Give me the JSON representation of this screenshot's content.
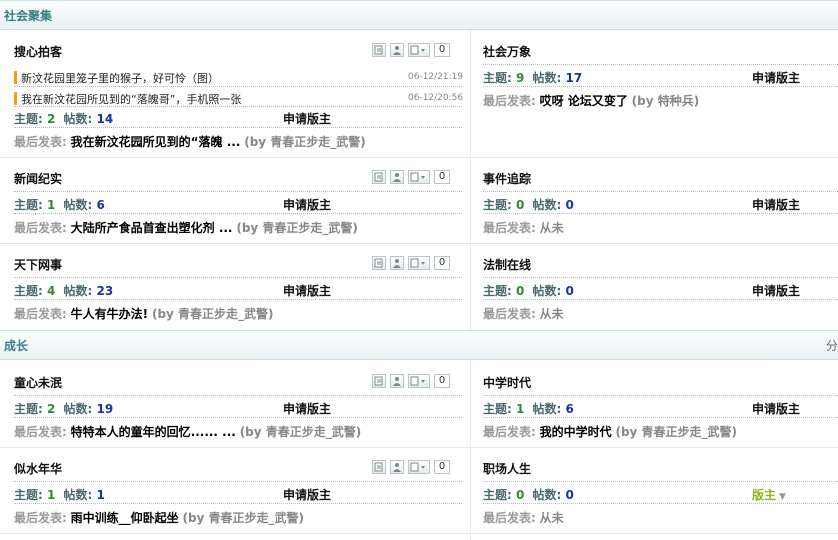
{
  "sections": {
    "s1": {
      "title": "社会聚集"
    },
    "s2": {
      "title": "成长",
      "right_glyph": "分"
    }
  },
  "labels": {
    "topics": "主题:",
    "posts": "帖数:",
    "last_post": "最后发表:",
    "never": "从未",
    "apply_moderator": "申请版主",
    "moderator": "版主"
  },
  "forums": {
    "f1": {
      "name": "搜心拍客",
      "tool_count": "0",
      "topics": "2",
      "posts": "14",
      "last_title": "我在新汶花园所见到的“落魄 ...",
      "last_by": "(by 青春正步走_武警)",
      "threads": [
        {
          "title": "新汶花园里笼子里的猴子，好可怜（图）",
          "date": "06-12/21:19"
        },
        {
          "title": "我在新汶花园所见到的“落魄哥”，手机照一张",
          "date": "06-12/20:56"
        }
      ]
    },
    "f2": {
      "name": "社会万象",
      "topics": "9",
      "posts": "17",
      "last_title": "哎呀 论坛又变了",
      "last_by": "(by 特种兵)"
    },
    "f3": {
      "name": "新闻纪实",
      "tool_count": "0",
      "topics": "1",
      "posts": "6",
      "last_title": "大陆所产食品首查出塑化剂 ...",
      "last_by": "(by 青春正步走_武警)"
    },
    "f4": {
      "name": "事件追踪",
      "topics": "0",
      "posts": "0"
    },
    "f5": {
      "name": "天下网事",
      "tool_count": "0",
      "topics": "4",
      "posts": "23",
      "last_title": "牛人有牛办法!",
      "last_by": "(by 青春正步走_武警)"
    },
    "f6": {
      "name": "法制在线",
      "topics": "0",
      "posts": "0"
    },
    "f7": {
      "name": "童心未泯",
      "tool_count": "0",
      "topics": "2",
      "posts": "19",
      "last_title": "特特本人的童年的回忆...... ...",
      "last_by": "(by 青春正步走_武警)"
    },
    "f8": {
      "name": "中学时代",
      "topics": "1",
      "posts": "6",
      "last_title": "我的中学时代",
      "last_by": "(by 青春正步走_武警)"
    },
    "f9": {
      "name": "似水年华",
      "tool_count": "0",
      "topics": "1",
      "posts": "1",
      "last_title": "雨中训练__仰卧起坐",
      "last_by": "(by 青春正步走_武警)"
    },
    "f10": {
      "name": "职场人生",
      "topics": "0",
      "posts": "0"
    }
  },
  "icons": {
    "tool_1": "new-post-icon",
    "tool_2": "moderator-icon",
    "tool_3": "expand-menu-icon"
  },
  "colors": {
    "section_title": "#3a7f87",
    "topic_count": "#2e8b2e",
    "post_count": "#1a34a0",
    "thread_marker": "#f0a01c",
    "moderator_green": "#8fb61e"
  }
}
